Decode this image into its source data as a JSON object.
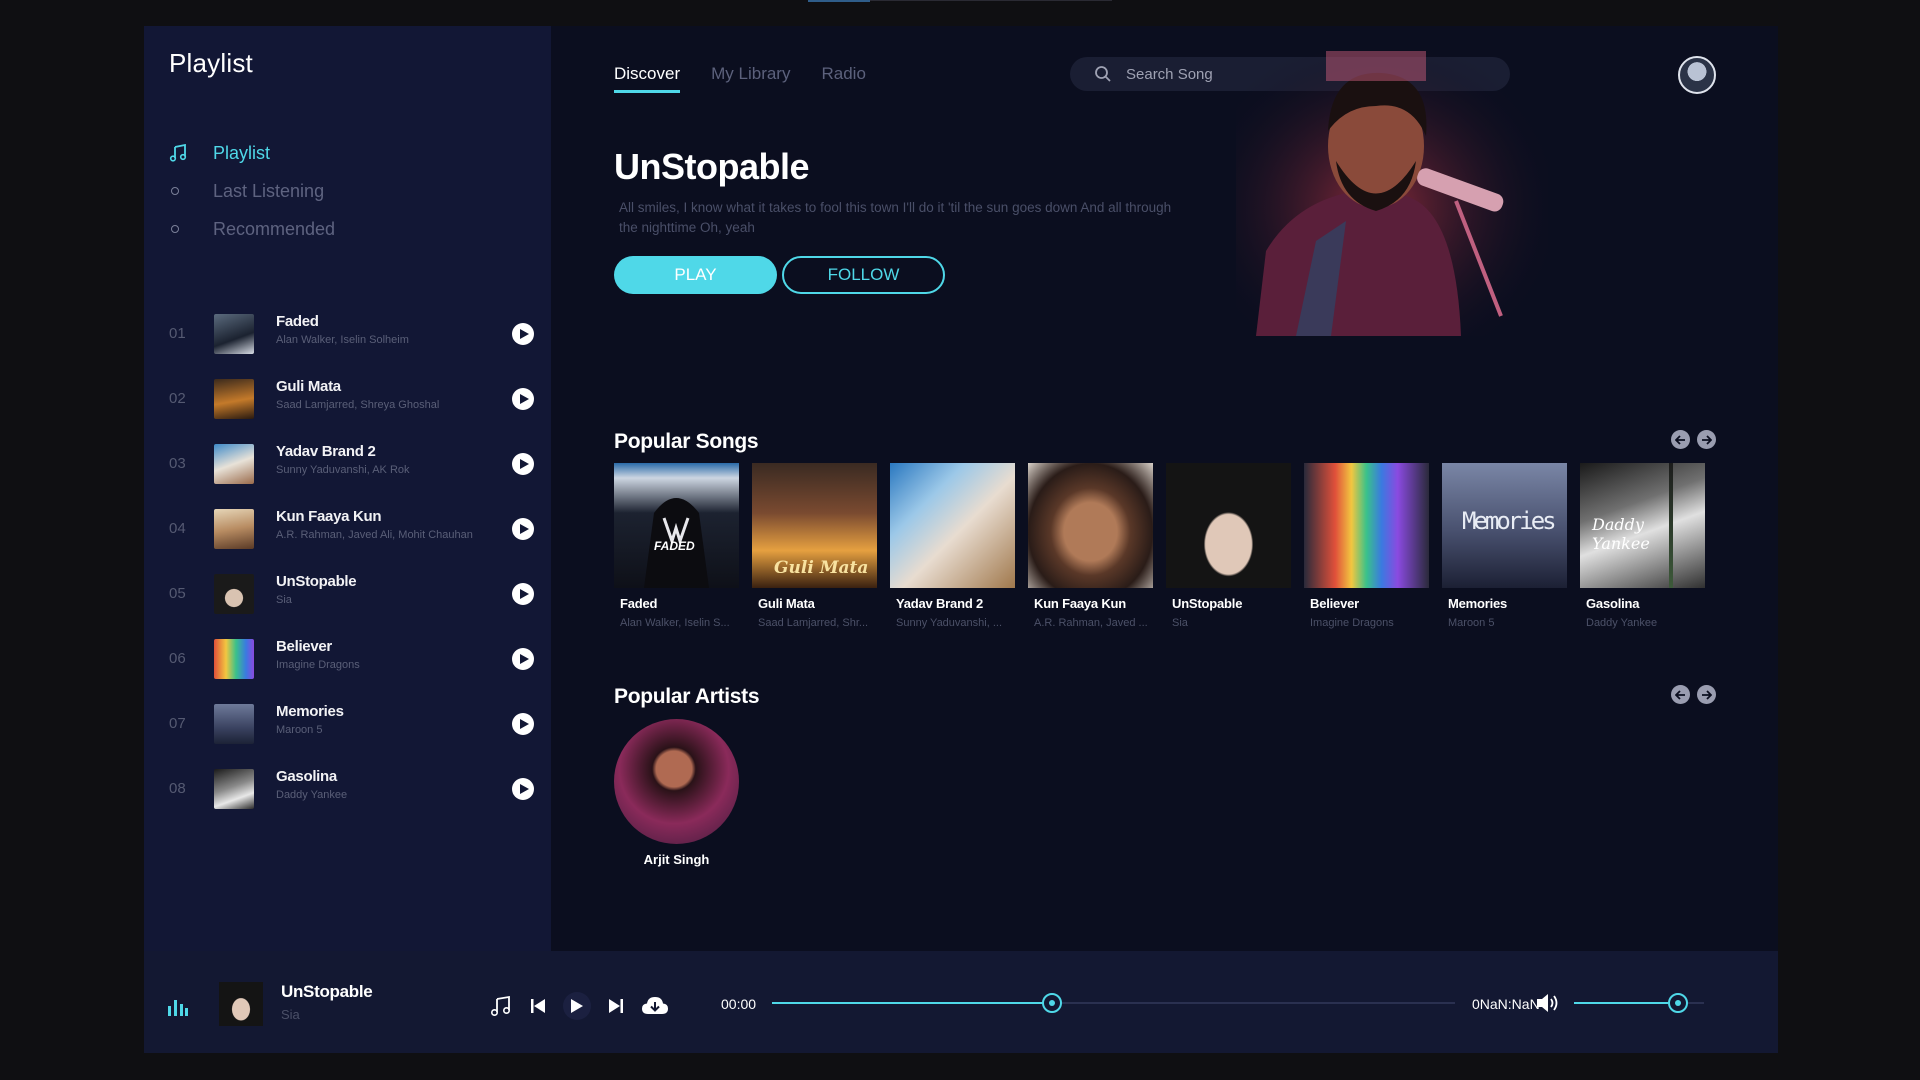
{
  "sidebar": {
    "title": "Playlist",
    "nav": [
      {
        "label": "Playlist",
        "icon": "music-note-icon",
        "active": true
      },
      {
        "label": "Last Listening",
        "icon": "dot-icon",
        "active": false
      },
      {
        "label": "Recommended",
        "icon": "dot-icon",
        "active": false
      }
    ],
    "tracks": [
      {
        "num": "01",
        "title": "Faded",
        "artist": "Alan Walker, Iselin Solheim"
      },
      {
        "num": "02",
        "title": "Guli Mata",
        "artist": "Saad Lamjarred, Shreya Ghoshal"
      },
      {
        "num": "03",
        "title": "Yadav Brand 2",
        "artist": "Sunny Yaduvanshi, AK Rok"
      },
      {
        "num": "04",
        "title": "Kun Faaya Kun",
        "artist": "A.R. Rahman, Javed Ali, Mohit Chauhan"
      },
      {
        "num": "05",
        "title": "UnStopable",
        "artist": "Sia"
      },
      {
        "num": "06",
        "title": "Believer",
        "artist": "Imagine Dragons"
      },
      {
        "num": "07",
        "title": "Memories",
        "artist": "Maroon 5"
      },
      {
        "num": "08",
        "title": "Gasolina",
        "artist": "Daddy Yankee"
      }
    ]
  },
  "header": {
    "tabs": [
      {
        "label": "Discover",
        "active": true
      },
      {
        "label": "My Library",
        "active": false
      },
      {
        "label": "Radio",
        "active": false
      }
    ],
    "search_placeholder": "Search Song"
  },
  "hero": {
    "title": "UnStopable",
    "description": "All smiles, I know what it takes to fool this town I'll do it 'til the sun goes down And all through the nighttime Oh, yeah",
    "play_label": "PLAY",
    "follow_label": "FOLLOW"
  },
  "popular_songs": {
    "title": "Popular Songs",
    "items": [
      {
        "title": "Faded",
        "artist": "Alan Walker, Iselin S..."
      },
      {
        "title": "Guli Mata",
        "artist": "Saad Lamjarred, Shr..."
      },
      {
        "title": "Yadav Brand 2",
        "artist": "Sunny Yaduvanshi, ..."
      },
      {
        "title": "Kun Faaya Kun",
        "artist": "A.R. Rahman, Javed ..."
      },
      {
        "title": "UnStopable",
        "artist": "Sia"
      },
      {
        "title": "Believer",
        "artist": "Imagine Dragons"
      },
      {
        "title": "Memories",
        "artist": "Maroon 5"
      },
      {
        "title": "Gasolina",
        "artist": "Daddy Yankee"
      }
    ],
    "cover_text": {
      "faded": "FADED",
      "guli": "Guli Mata",
      "memories": "Memories",
      "gasolina": "Daddy Yankee"
    }
  },
  "popular_artists": {
    "title": "Popular Artists",
    "items": [
      {
        "name": "Arjit Singh"
      }
    ]
  },
  "player": {
    "title": "UnStopable",
    "artist": "Sia",
    "current_time": "00:00",
    "total_time": "0NaN:NaN",
    "progress": 0.41,
    "volume": 0.8
  },
  "colors": {
    "accent": "#4fd8e8",
    "sidebar_bg": "#121735",
    "main_bg": "#0b0e1f",
    "player_bg": "#131832"
  }
}
